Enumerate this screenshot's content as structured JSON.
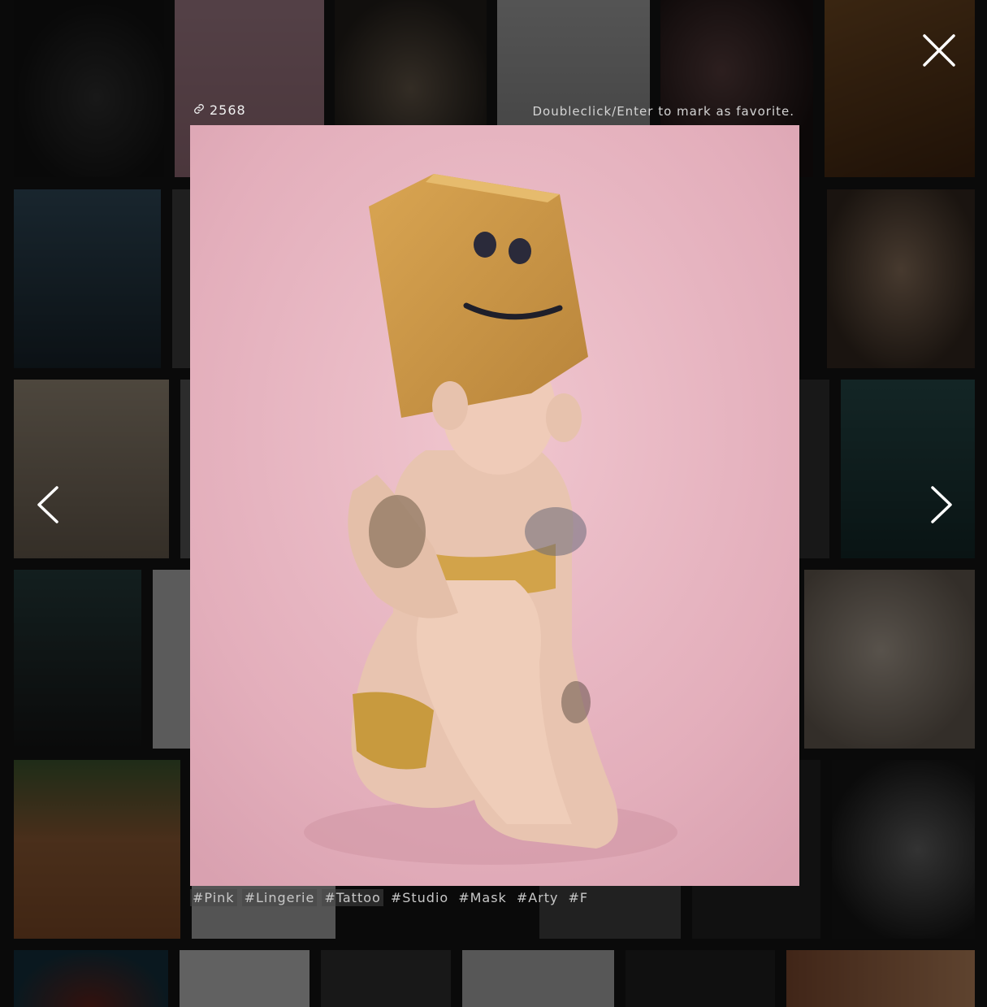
{
  "viewer": {
    "count": "2568",
    "hint": "Doubleclick/Enter to mark as favorite.",
    "tags": [
      "#Pink",
      "#Lingerie",
      "#Tattoo",
      "#Studio",
      "#Mask",
      "#Arty",
      "#F"
    ]
  },
  "icons": {
    "link": "link-icon",
    "close": "close-icon",
    "prev": "chevron-left-icon",
    "next": "chevron-right-icon"
  },
  "colors": {
    "background": "#0a0a0a",
    "photo_backdrop": "#e8b8c4",
    "text": "#f0f0f0"
  }
}
